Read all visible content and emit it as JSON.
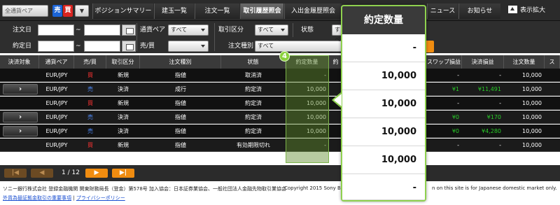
{
  "nav": {
    "pair_select": "全通貨ペア",
    "sell": "売",
    "buy": "買",
    "tabs": [
      "ポジションサマリー",
      "建玉一覧",
      "注文一覧",
      "取引履歴照会",
      "入出金履歴照会",
      "ニュース",
      "お知らせ"
    ],
    "active_tab": "取引履歴照会",
    "expand": "表示拡大"
  },
  "filter": {
    "order_date_label": "注文日",
    "contract_date_label": "約定日",
    "tilde": "~",
    "pair_label": "通貨ペア",
    "pair_value": "すべて",
    "side_label": "売/買",
    "trade_type_label": "取引区分",
    "trade_type_value": "すべて",
    "order_type_label": "注文種別",
    "order_type_value": "すべて",
    "status_label": "状態",
    "status_value": "すべ"
  },
  "table": {
    "headers": [
      "決済対象",
      "通貨ペア",
      "売/買",
      "取引区分",
      "注文種別",
      "状態",
      "約定数量",
      "約",
      "スワップ損益",
      "決済損益",
      "注文数量",
      "ス"
    ],
    "detail_glyph": "›",
    "rows": [
      {
        "has_detail": false,
        "pair": "EUR/JPY",
        "side": "買",
        "side_color": "red",
        "trade": "新規",
        "order_type": "指値",
        "status": "取消済",
        "qty": "-",
        "swap": "-",
        "swap_color": "white",
        "pnl": "-",
        "pnl_color": "white",
        "order_qty": "10,000"
      },
      {
        "has_detail": true,
        "pair": "EUR/JPY",
        "side": "売",
        "side_color": "blue",
        "trade": "決済",
        "order_type": "成行",
        "status": "約定済",
        "qty": "10,000",
        "swap": "¥1",
        "swap_color": "green",
        "pnl": "¥11,491",
        "pnl_color": "green",
        "order_qty": "10,000"
      },
      {
        "has_detail": false,
        "pair": "EUR/JPY",
        "side": "買",
        "side_color": "red",
        "trade": "新規",
        "order_type": "指値",
        "status": "約定済",
        "qty": "10,000",
        "swap": "-",
        "swap_color": "white",
        "pnl": "-",
        "pnl_color": "white",
        "order_qty": "10,000"
      },
      {
        "has_detail": true,
        "pair": "EUR/JPY",
        "side": "売",
        "side_color": "blue",
        "trade": "決済",
        "order_type": "指値",
        "status": "約定済",
        "qty": "10,000",
        "swap": "¥0",
        "swap_color": "green",
        "pnl": "¥170",
        "pnl_color": "green",
        "order_qty": "10,000"
      },
      {
        "has_detail": true,
        "pair": "EUR/JPY",
        "side": "売",
        "side_color": "blue",
        "trade": "決済",
        "order_type": "指値",
        "status": "約定済",
        "qty": "10,000",
        "swap": "¥0",
        "swap_color": "green",
        "pnl": "¥4,280",
        "pnl_color": "green",
        "order_qty": "10,000"
      },
      {
        "has_detail": false,
        "pair": "EUR/JPY",
        "side": "買",
        "side_color": "red",
        "trade": "新規",
        "order_type": "指値",
        "status": "有効期限切れ",
        "qty": "-",
        "swap": "-",
        "swap_color": "white",
        "pnl": "-",
        "pnl_color": "white",
        "order_qty": "10,000"
      }
    ]
  },
  "badge": "4",
  "pager": {
    "first": "|◀",
    "prev": "◀",
    "page": "1 / 12",
    "next": "▶",
    "last": "▶|"
  },
  "footer": {
    "company": "ソニー銀行株式会社 登録金融機関 関東財務局長（登金）第578号 加入協会：日本証券業協会、一般社団法人金融先物取引業協会",
    "copyright": "Copyright 2015 Sony Ban",
    "notice": "n on this site is for Japanese domestic market only.",
    "link1": "外貨為替証拠金取引の重要事項",
    "link2": "プライバシーポリシー"
  },
  "callout": {
    "header": "約定数量",
    "values": [
      "-",
      "10,000",
      "10,000",
      "10,000",
      "10,000",
      "-"
    ]
  }
}
